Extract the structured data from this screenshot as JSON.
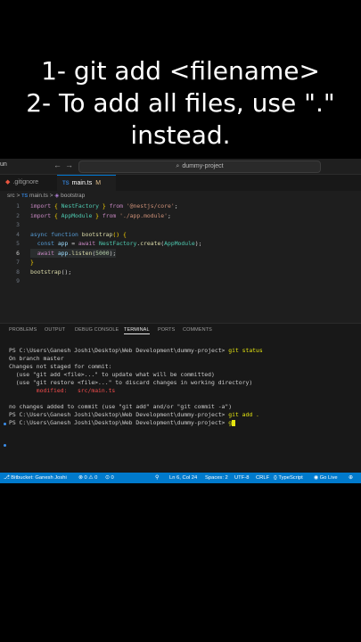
{
  "caption": {
    "line1": "1- git add <filename>",
    "line2": "2- To add all files, use \".\"",
    "line3": "instead."
  },
  "titlebar": {
    "menu_run": "un",
    "nav_back": "←",
    "nav_forward": "→",
    "command_center": "dummy-project"
  },
  "tabs": [
    {
      "label": ".gitignore"
    },
    {
      "label": "main.ts",
      "modified": "M"
    }
  ],
  "breadcrumb": {
    "folder": "src",
    "sep1": ">",
    "file": "main.ts",
    "sep2": ">",
    "symbol": "bootstrap"
  },
  "editor": {
    "line_numbers": [
      "1",
      "2",
      "3",
      "4",
      "5",
      "6",
      "7",
      "8",
      "9"
    ]
  },
  "panel": {
    "tabs": [
      "PROBLEMS",
      "OUTPUT",
      "DEBUG CONSOLE",
      "TERMINAL",
      "PORTS",
      "COMMENTS"
    ],
    "active_tab": "TERMINAL"
  },
  "terminal": {
    "l1_prompt": "PS C:\\Users\\Ganesh Joshi\\Desktop\\Web Development\\dummy-project> ",
    "l1_cmd": "git status",
    "l2": "On branch master",
    "l3": "Changes not staged for commit:",
    "l4": "  (use \"git add <file>...\" to update what will be committed)",
    "l5": "  (use \"git restore <file>...\" to discard changes in working directory)",
    "l6_label": "        modified:   ",
    "l6_file": "src/main.ts",
    "l7": "no changes added to commit (use \"git add\" and/or \"git commit -a\")",
    "l8_prompt": "PS C:\\Users\\Ganesh Joshi\\Desktop\\Web Development\\dummy-project> ",
    "l8_cmd": "git add .",
    "l9_prompt": "PS C:\\Users\\Ganesh Joshi\\Desktop\\Web Development\\dummy-project> ",
    "l9_cmd": "g"
  },
  "statusbar": {
    "bitbucket": "Bitbucket: Ganesh Joshi",
    "errors": "⊗ 0 ⚠ 0",
    "ports": "0",
    "cursor": "Ln 6, Col 24",
    "spaces": "Spaces: 2",
    "encoding": "UTF-8",
    "eol": "CRLF",
    "language": "{} TypeScript",
    "golive": "Go Live"
  },
  "colors": {
    "statusbar": "#007acc",
    "terminal_bg": "#181818",
    "editor_bg": "#1e1e1e"
  }
}
